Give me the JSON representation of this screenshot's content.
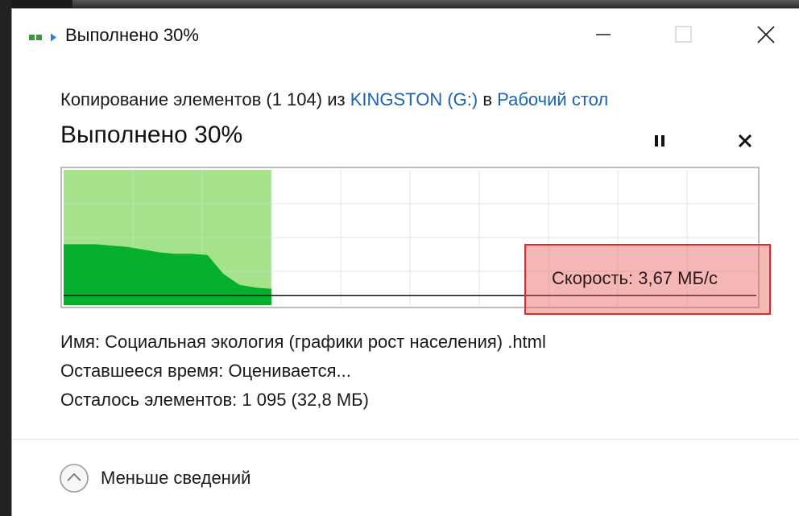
{
  "window": {
    "title": "Выполнено 30%",
    "icon": "copy-arrow-icon"
  },
  "titlebar_buttons": {
    "minimize_icon": "minimize-icon",
    "maximize_icon": "maximize-icon",
    "close_icon": "close-icon"
  },
  "header": {
    "copy_prefix": "Копирование элементов (1 104) из",
    "source_link": "KINGSTON (G:)",
    "copy_middle": "в",
    "destination_link": "Рабочий стол",
    "status": "Выполнено 30%"
  },
  "controls": {
    "pause_icon": "pause-icon",
    "stop_icon": "stop-icon"
  },
  "progress": {
    "percent": 30,
    "speed_label": "Скорость: 3,67 МБ/с",
    "speed_history_fraction": [
      0.45,
      0.45,
      0.45,
      0.44,
      0.43,
      0.41,
      0.39,
      0.38,
      0.38,
      0.37,
      0.23,
      0.15,
      0.13,
      0.12
    ],
    "average_fraction": 0.07
  },
  "colors": {
    "progress_fill": "#a4e28b",
    "speed_area": "#06b02c",
    "grid": "#b9e6b9",
    "grid_outside": "#dfe7df",
    "link": "#1a63b3",
    "highlight": "#e02a2a"
  },
  "details": {
    "name_label": "Имя:",
    "name_value": "Социальная экология (графики рост населения) .html",
    "time_label": "Оставшееся время:",
    "time_value": "Оценивается...",
    "items_label": "Осталось элементов:",
    "items_value": "1 095 (32,8 МБ)"
  },
  "footer": {
    "less_details_label": "Меньше сведений",
    "less_details_icon": "chevron-up-circle-icon"
  }
}
